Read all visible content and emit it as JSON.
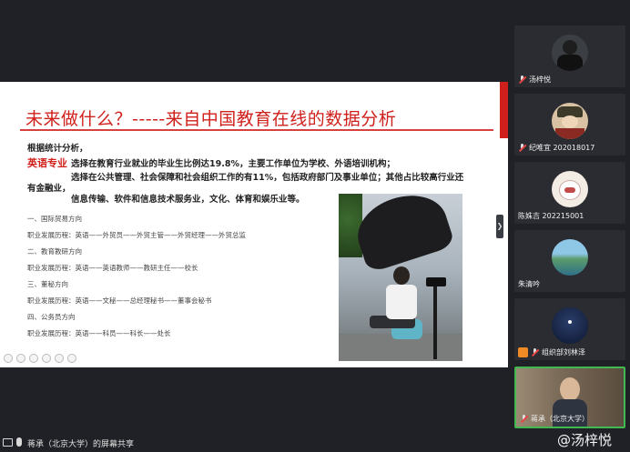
{
  "slide": {
    "title": "未来做什么？-----来自中国教育在线的数据分析",
    "intro": "根据统计分析，",
    "english_label": "英语专业",
    "line1": "选择在教育行业就业的毕业生比例达19.8%，主要工作单位为学校、外语培训机构；",
    "line2": "选择在公共管理、社会保障和社会组织工作的有11%，包括政府部门及事业单位；其他占比较高行业还",
    "line3": "有金融业，",
    "line4": "信息传输、软件和信息技术服务业，文化、体育和娱乐业等。",
    "careers": [
      "一、国际贸易方向",
      "职业发展历程：英语——外贸员——外贸主管——外贸经理——外贸总监",
      "二、教育教研方向",
      "职业发展历程：英语——英语教师——教研主任——校长",
      "三、董秘方向",
      "职业发展历程：英语——文秘——总经理秘书——董事会秘书",
      "四、公务员方向",
      "职业发展历程：英语——科员——科长——处长"
    ]
  },
  "participants": [
    {
      "name": "汤梓悦",
      "avatar_color": "#3b3f44"
    },
    {
      "name": "纪唯宜 202018017",
      "avatar_color": "#c7a27a"
    },
    {
      "name": "陈姝吉 202215001",
      "avatar_color": "#e8d8c8"
    },
    {
      "name": "朱清吟",
      "avatar_color": "#4a8a8a"
    },
    {
      "name": "组织部刘林泽",
      "avatar_color": "#1b2a4a"
    },
    {
      "name": "蒋承（北京大学）",
      "avatar_color": "#8a7a68"
    }
  ],
  "share_status": "蒋承（北京大学）的屏幕共享",
  "watermark": "@汤梓悦"
}
